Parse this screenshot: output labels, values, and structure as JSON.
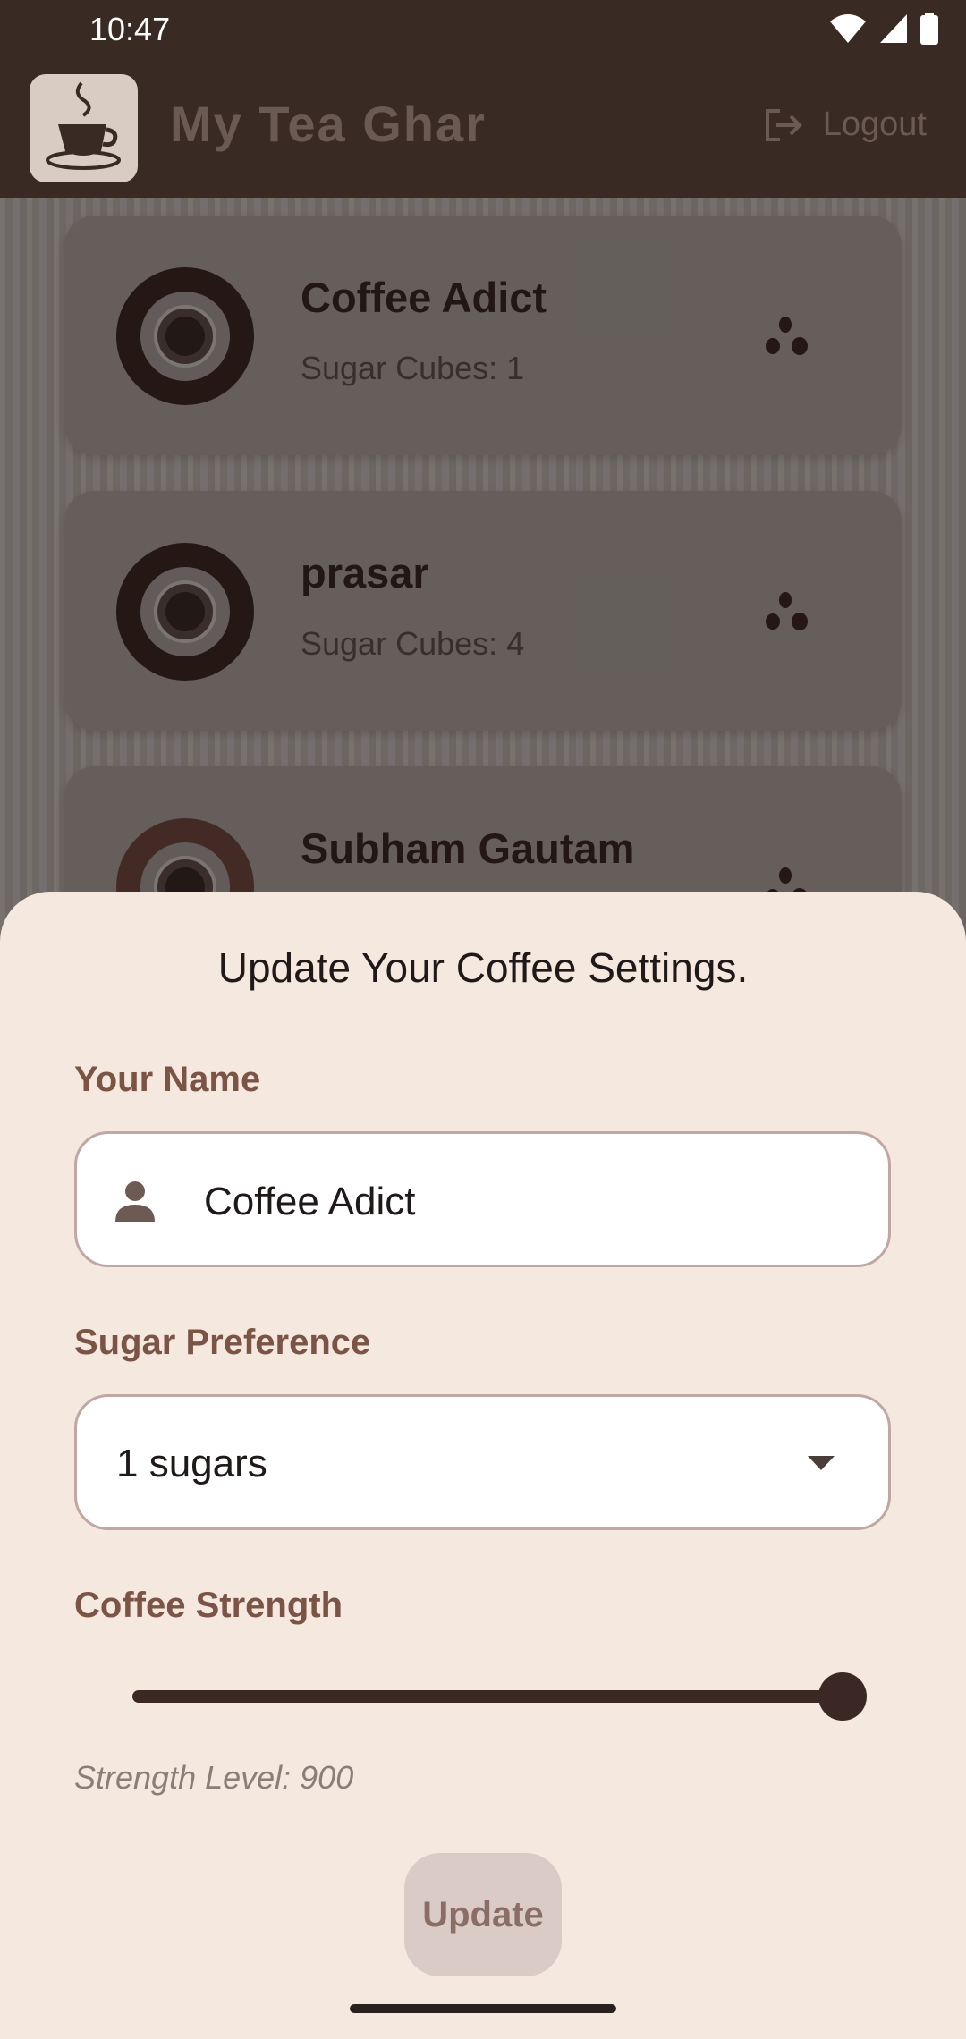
{
  "status_bar": {
    "time": "10:47"
  },
  "app_bar": {
    "title": "My Tea Ghar",
    "logout_label": "Logout"
  },
  "list": {
    "items": [
      {
        "name": "Coffee Adict",
        "sugar_text": "Sugar Cubes: 1"
      },
      {
        "name": "prasar",
        "sugar_text": "Sugar Cubes: 4"
      },
      {
        "name": "Subham Gautam",
        "sugar_text": ""
      }
    ]
  },
  "sheet": {
    "title": "Update Your Coffee Settings.",
    "name_label": "Your Name",
    "name_value": "Coffee Adict",
    "sugar_label": "Sugar Preference",
    "sugar_value": "1 sugars",
    "strength_label": "Coffee Strength",
    "strength_fraction": 1.0,
    "strength_text": "Strength Level: 900",
    "update_label": "Update"
  },
  "colors": {
    "accent": "#3b2824",
    "sheet_bg": "#f4e8df",
    "label": "#7b5446"
  }
}
